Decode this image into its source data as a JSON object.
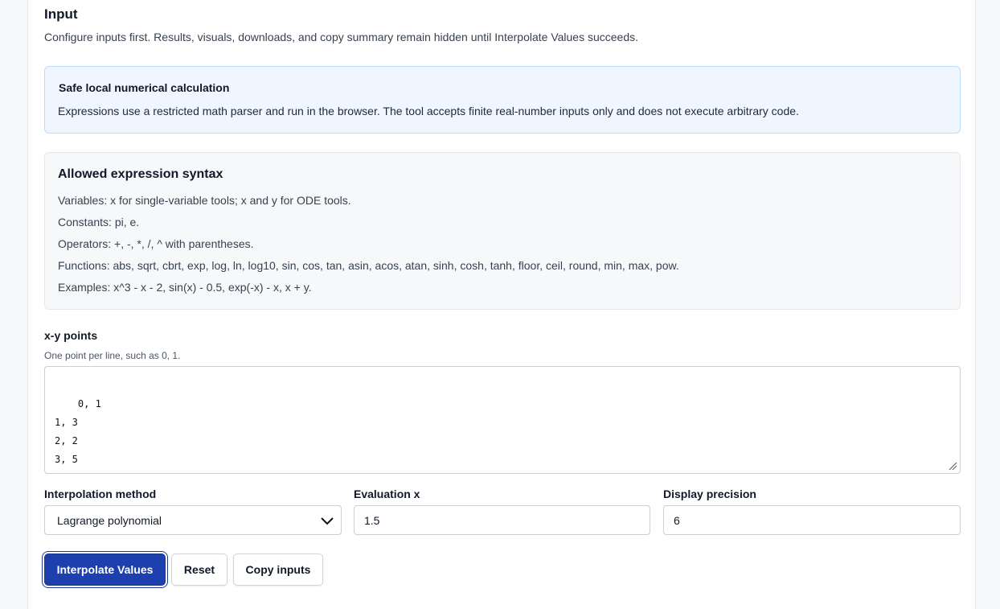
{
  "header": {
    "title": "Input",
    "intro": "Configure inputs first. Results, visuals, downloads, and copy summary remain hidden until Interpolate Values succeeds."
  },
  "notice": {
    "title": "Safe local numerical calculation",
    "body": "Expressions use a restricted math parser and run in the browser. The tool accepts finite real-number inputs only and does not execute arbitrary code."
  },
  "syntax": {
    "title": "Allowed expression syntax",
    "lines": [
      "Variables: x for single-variable tools; x and y for ODE tools.",
      "Constants: pi, e.",
      "Operators: +, -, *, /, ^ with parentheses.",
      "Functions: abs, sqrt, cbrt, exp, log, ln, log10, sin, cos, tan, asin, acos, atan, sinh, cosh, tanh, floor, ceil, round, min, max, pow.",
      "Examples: x^3 - x - 2, sin(x) - 0.5, exp(-x) - x, x + y."
    ]
  },
  "points_field": {
    "label": "x-y points",
    "hint": "One point per line, such as 0, 1.",
    "value": "0, 1\n1, 3\n2, 2\n3, 5"
  },
  "method_field": {
    "label": "Interpolation method",
    "value": "Lagrange polynomial"
  },
  "eval_field": {
    "label": "Evaluation x",
    "value": "1.5"
  },
  "precision_field": {
    "label": "Display precision",
    "value": "6"
  },
  "actions": {
    "interpolate": "Interpolate Values",
    "reset": "Reset",
    "copy": "Copy inputs"
  },
  "colors": {
    "primary": "#1e40af",
    "notice_bg": "#eff6ff",
    "notice_border": "#bfdbfe"
  }
}
